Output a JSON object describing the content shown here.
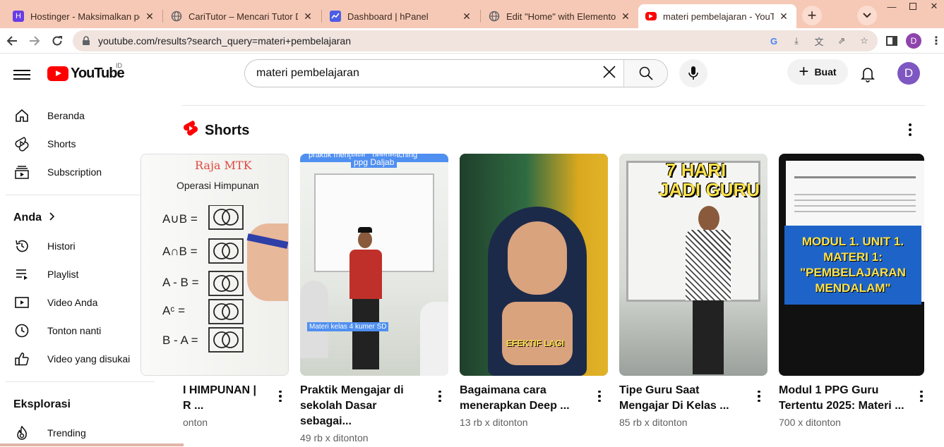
{
  "browser": {
    "tabs": [
      {
        "title": "Hostinger - Maksimalkan pote",
        "fav_color": "#673de6",
        "fav_letter": "H"
      },
      {
        "title": "CariTutor – Mencari Tutor Den",
        "fav_color": "#5f6368",
        "fav_letter": ""
      },
      {
        "title": "Dashboard | hPanel",
        "fav_color": "#4c5ce6",
        "fav_letter": ""
      },
      {
        "title": "Edit \"Home\" with Elementor",
        "fav_color": "#5f6368",
        "fav_letter": ""
      },
      {
        "title": "materi pembelajaran - YouTub",
        "fav_color": "#ff0000",
        "fav_letter": ""
      }
    ],
    "url": "youtube.com/results?search_query=materi+pembelajaran",
    "profile_letter": "D"
  },
  "header": {
    "logo_text": "YouTube",
    "country_code": "ID",
    "search_value": "materi pembelajaran",
    "create_label": "Buat",
    "avatar_letter": "D"
  },
  "sidebar": {
    "main": [
      {
        "label": "Beranda",
        "icon": "home-icon"
      },
      {
        "label": "Shorts",
        "icon": "shorts-icon"
      },
      {
        "label": "Subscription",
        "icon": "subscriptions-icon"
      }
    ],
    "you_heading": "Anda",
    "you": [
      {
        "label": "Histori",
        "icon": "history-icon"
      },
      {
        "label": "Playlist",
        "icon": "playlist-icon"
      },
      {
        "label": "Video Anda",
        "icon": "your-videos-icon"
      },
      {
        "label": "Tonton nanti",
        "icon": "watch-later-icon"
      },
      {
        "label": "Video yang disukai",
        "icon": "liked-icon"
      }
    ],
    "explore_heading": "Eksplorasi",
    "explore": [
      {
        "label": "Trending",
        "icon": "trending-icon"
      }
    ]
  },
  "shorts": {
    "heading": "Shorts",
    "items": [
      {
        "title": "I HIMPUNAN |\nR ...",
        "views": "onton",
        "thumb_text": [
          "Raja MTK",
          "Operasi Himpunan",
          "A∪B =",
          "A∩B =",
          "A - B =",
          "Aᶜ =",
          "B - A ="
        ]
      },
      {
        "title": "Praktik Mengajar di\nsekolah Dasar sebagai...",
        "views": "49 rb x ditonton",
        "thumb_text": [
          "praktik mengajar_ peerteaching",
          "ppg Daljab",
          "Materi kelas 4 kumer SD"
        ]
      },
      {
        "title": "Bagaimana cara\nmenerapkan Deep ...",
        "views": "13 rb x ditonton",
        "thumb_text": [
          "EFEKTIF LAGI"
        ]
      },
      {
        "title": "Tipe Guru Saat\nMengajar Di Kelas ...",
        "views": "85 rb x ditonton",
        "thumb_text": [
          "7 HARI",
          "JADI GURU"
        ]
      },
      {
        "title": "Modul 1 PPG Guru\nTertentu 2025: Materi ...",
        "views": "700 x ditonton",
        "thumb_text": [
          "MODUL 1. UNIT 1.",
          "MATERI 1:",
          "\"PEMBELAJARAN",
          "MENDALAM\""
        ]
      }
    ]
  }
}
